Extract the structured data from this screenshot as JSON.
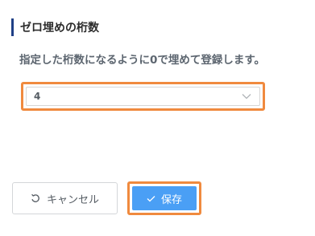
{
  "section": {
    "title": "ゼロ埋めの桁数",
    "description": "指定した桁数になるように0で埋めて登録します。"
  },
  "digits_select": {
    "value": "4",
    "icon": "chevron-down-icon"
  },
  "actions": {
    "cancel_label": "キャンセル",
    "cancel_icon": "undo-icon",
    "save_label": "保存",
    "save_icon": "check-icon"
  },
  "colors": {
    "accent_bar": "#1f3f86",
    "highlight": "#f08a3e",
    "primary_button": "#4a9ff5"
  }
}
